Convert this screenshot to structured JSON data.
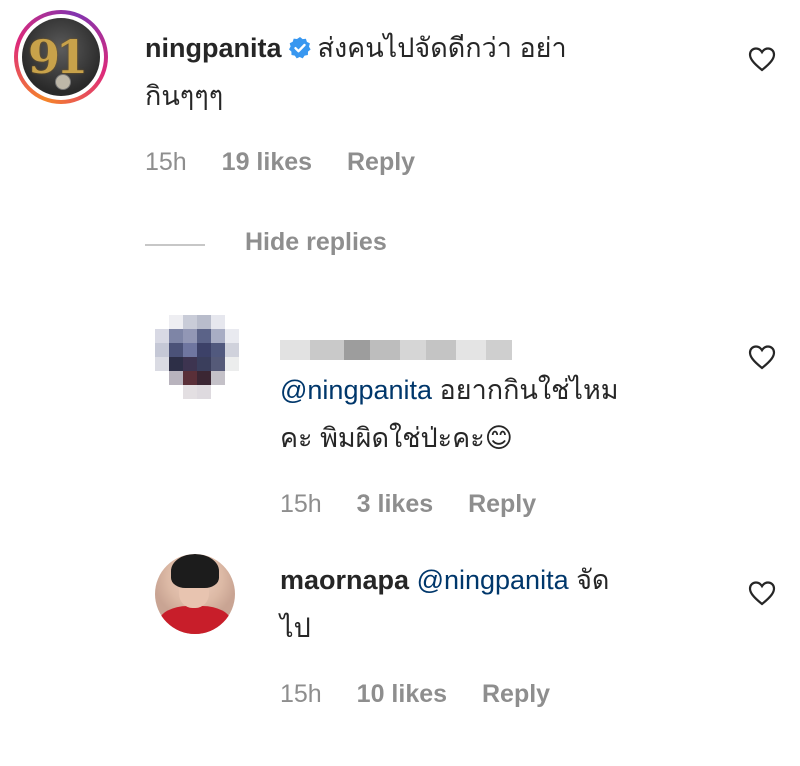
{
  "comments": [
    {
      "username": "ningpanita",
      "verified": true,
      "text_line1": "ส่งคนไปจัดดีกว่า อย่า",
      "text_line2": "กินๆๆๆ",
      "time": "15h",
      "likes": "19 likes",
      "reply": "Reply",
      "avatar_text": "91"
    },
    {
      "mention": "@ningpanita",
      "text_line1_rest": " อยากกินใช่ไหม",
      "text_line2": "คะ พิมผิดใช่ป่ะคะ😊",
      "time": "15h",
      "likes": "3 likes",
      "reply": "Reply"
    },
    {
      "username": "maornapa",
      "mention": "@ningpanita",
      "text_line1_rest": " จัด",
      "text_line2": "ไป",
      "time": "15h",
      "likes": "10 likes",
      "reply": "Reply"
    }
  ],
  "thread": {
    "hide_replies": "Hide replies"
  },
  "icons": {
    "like": "heart-outline-icon",
    "verified": "verified-badge-icon"
  },
  "colors": {
    "text": "#262626",
    "muted": "#8e8e8e",
    "mention": "#00376b",
    "verified": "#3897f0"
  }
}
